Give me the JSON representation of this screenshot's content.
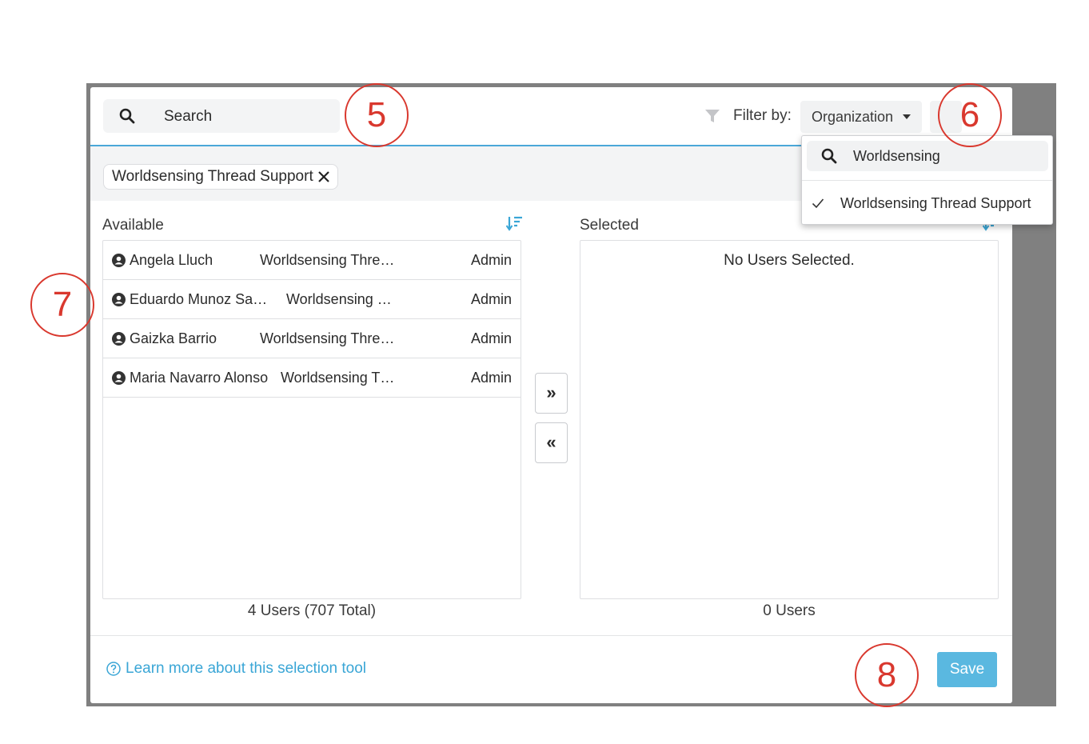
{
  "header": {
    "search_placeholder": "Search",
    "filter_label": "Filter by:",
    "filter_dropdown_label": "Organization"
  },
  "chip": {
    "label": "Worldsensing Thread Support"
  },
  "available": {
    "title": "Available",
    "count": "4 Users (707 Total)",
    "rows": [
      {
        "name": "Angela Lluch",
        "org": "Worldsensing Thre…",
        "role": "Admin"
      },
      {
        "name": "Eduardo Munoz Sa…",
        "org": "Worldsensing …",
        "role": "Admin"
      },
      {
        "name": "Gaizka Barrio",
        "org": "Worldsensing Thre…",
        "role": "Admin"
      },
      {
        "name": "Maria Navarro Alonso",
        "org": "Worldsensing T…",
        "role": "Admin"
      }
    ]
  },
  "selected": {
    "title": "Selected",
    "empty_message": "No Users Selected.",
    "count": "0 Users"
  },
  "transfer": {
    "add_all_label": "»",
    "remove_all_label": "«"
  },
  "footer": {
    "help_link": "Learn more about this selection tool",
    "save_label": "Save"
  },
  "dropdown": {
    "search_value": "Worldsensing",
    "options": [
      {
        "label": "Worldsensing Thread Support",
        "checked": true
      }
    ]
  },
  "callouts": [
    "5",
    "6",
    "7",
    "8"
  ],
  "colors": {
    "accent": "#4aa8d8",
    "link": "#3aa6d6",
    "save_button": "#5ab8e0",
    "callout": "#d9382e",
    "backdrop": "#808080"
  },
  "icons": [
    "search-icon",
    "filter-icon",
    "close-icon",
    "sort-icon",
    "user-icon",
    "help-icon",
    "check-icon",
    "caret-down-icon"
  ]
}
